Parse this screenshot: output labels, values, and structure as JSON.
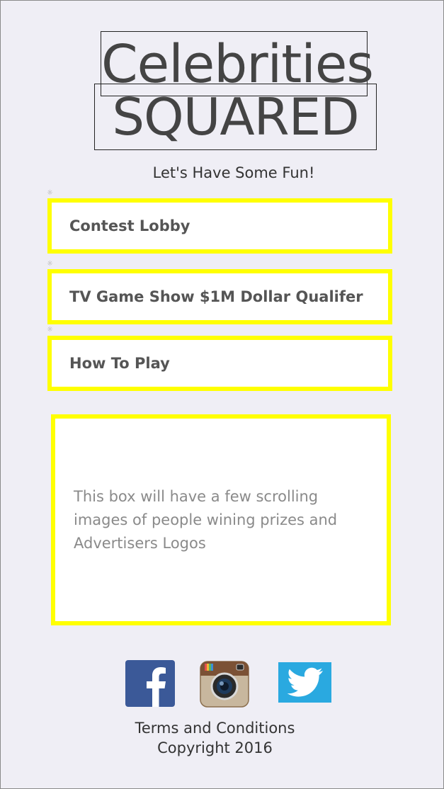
{
  "header": {
    "title_line1": "Celebrities",
    "title_line2": "SQUARED",
    "tagline": "Let's Have Some Fun!"
  },
  "menu": {
    "items": [
      {
        "label": "Contest Lobby"
      },
      {
        "label": "TV Game Show $1M Dollar Qualifer"
      },
      {
        "label": "How To Play"
      }
    ]
  },
  "promo": {
    "text": "This box will have a few scrolling images of people wining prizes and Advertisers Logos"
  },
  "social": {
    "icons": [
      "facebook-icon",
      "instagram-icon",
      "twitter-icon"
    ]
  },
  "footer": {
    "terms": "Terms and Conditions",
    "copyright": "Copyright 2016"
  },
  "colors": {
    "background": "#efeef5",
    "button_border": "#ffff00",
    "facebook": "#3b5998",
    "twitter": "#2aa9e0"
  }
}
